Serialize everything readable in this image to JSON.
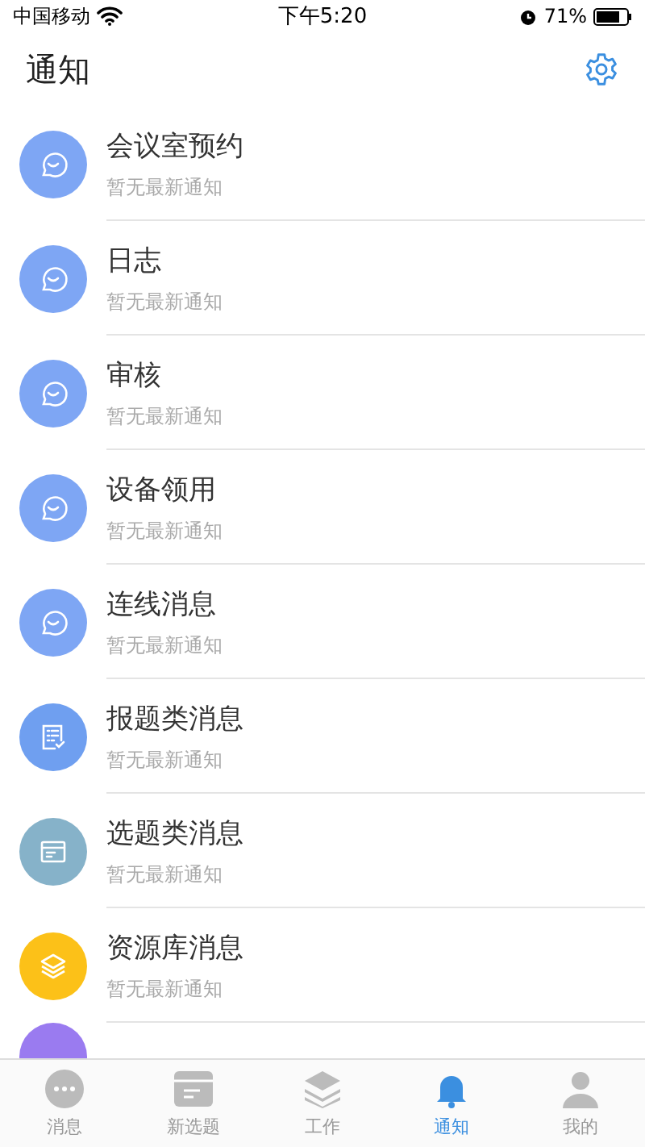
{
  "status_bar": {
    "carrier": "中国移动",
    "time": "下午5:20",
    "battery": "71%"
  },
  "header": {
    "title": "通知"
  },
  "items": [
    {
      "title": "会议室预约",
      "subtitle": "暂无最新通知",
      "kind": "smile",
      "color": "#7ea6f4"
    },
    {
      "title": "日志",
      "subtitle": "暂无最新通知",
      "kind": "smile",
      "color": "#7ea6f4"
    },
    {
      "title": "审核",
      "subtitle": "暂无最新通知",
      "kind": "smile",
      "color": "#7ea6f4"
    },
    {
      "title": "设备领用",
      "subtitle": "暂无最新通知",
      "kind": "smile",
      "color": "#7ea6f4"
    },
    {
      "title": "连线消息",
      "subtitle": "暂无最新通知",
      "kind": "smile",
      "color": "#7ea6f4"
    },
    {
      "title": "报题类消息",
      "subtitle": "暂无最新通知",
      "kind": "list",
      "color": "#6f9ff0"
    },
    {
      "title": "选题类消息",
      "subtitle": "暂无最新通知",
      "kind": "card",
      "color": "#86b2c9"
    },
    {
      "title": "资源库消息",
      "subtitle": "暂无最新通知",
      "kind": "layers",
      "color": "#fcc118"
    },
    {
      "kind": "partial",
      "color": "#9a7bf0"
    }
  ],
  "tabs": [
    {
      "label": "消息",
      "kind": "chat",
      "selected": false
    },
    {
      "label": "新选题",
      "kind": "card",
      "selected": false
    },
    {
      "label": "工作",
      "kind": "layers",
      "selected": false
    },
    {
      "label": "通知",
      "kind": "bell",
      "selected": true
    },
    {
      "label": "我的",
      "kind": "person",
      "selected": false
    }
  ]
}
